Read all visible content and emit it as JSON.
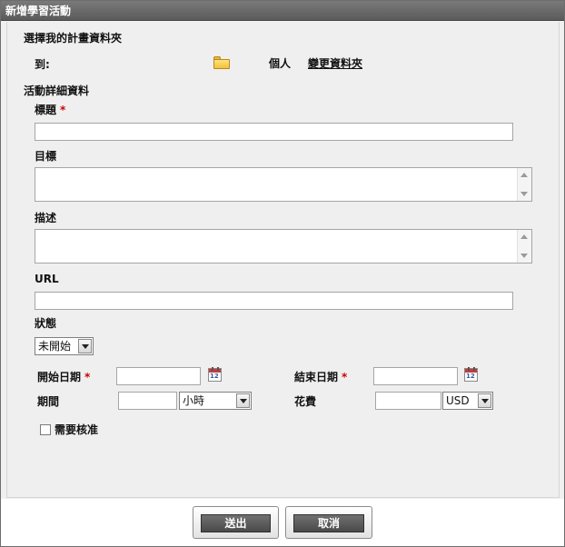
{
  "dialog": {
    "title": "新增學習活動"
  },
  "folder_section": {
    "heading": "選擇我的計畫資料夾",
    "to_label": "到:",
    "folder_name": "個人",
    "change_folder_link": "變更資料夾",
    "folder_icon": "folder-icon"
  },
  "details": {
    "heading": "活動詳細資料",
    "title_label": "標題",
    "required_mark": "*",
    "goal_label": "目標",
    "description_label": "描述",
    "url_label": "URL",
    "status_label": "狀態",
    "status_value": "未開始",
    "start_date_label": "開始日期",
    "end_date_label": "結束日期",
    "calendar_day": "12",
    "duration_label": "期間",
    "duration_unit": "小時",
    "cost_label": "花費",
    "currency": "USD",
    "approval_label": "需要核准",
    "approval_checked": false
  },
  "footer": {
    "submit_label": "送出",
    "cancel_label": "取消"
  },
  "colors": {
    "title_bar": "#5b5b5b",
    "required": "#d00000",
    "button": "#4a4a4a"
  }
}
